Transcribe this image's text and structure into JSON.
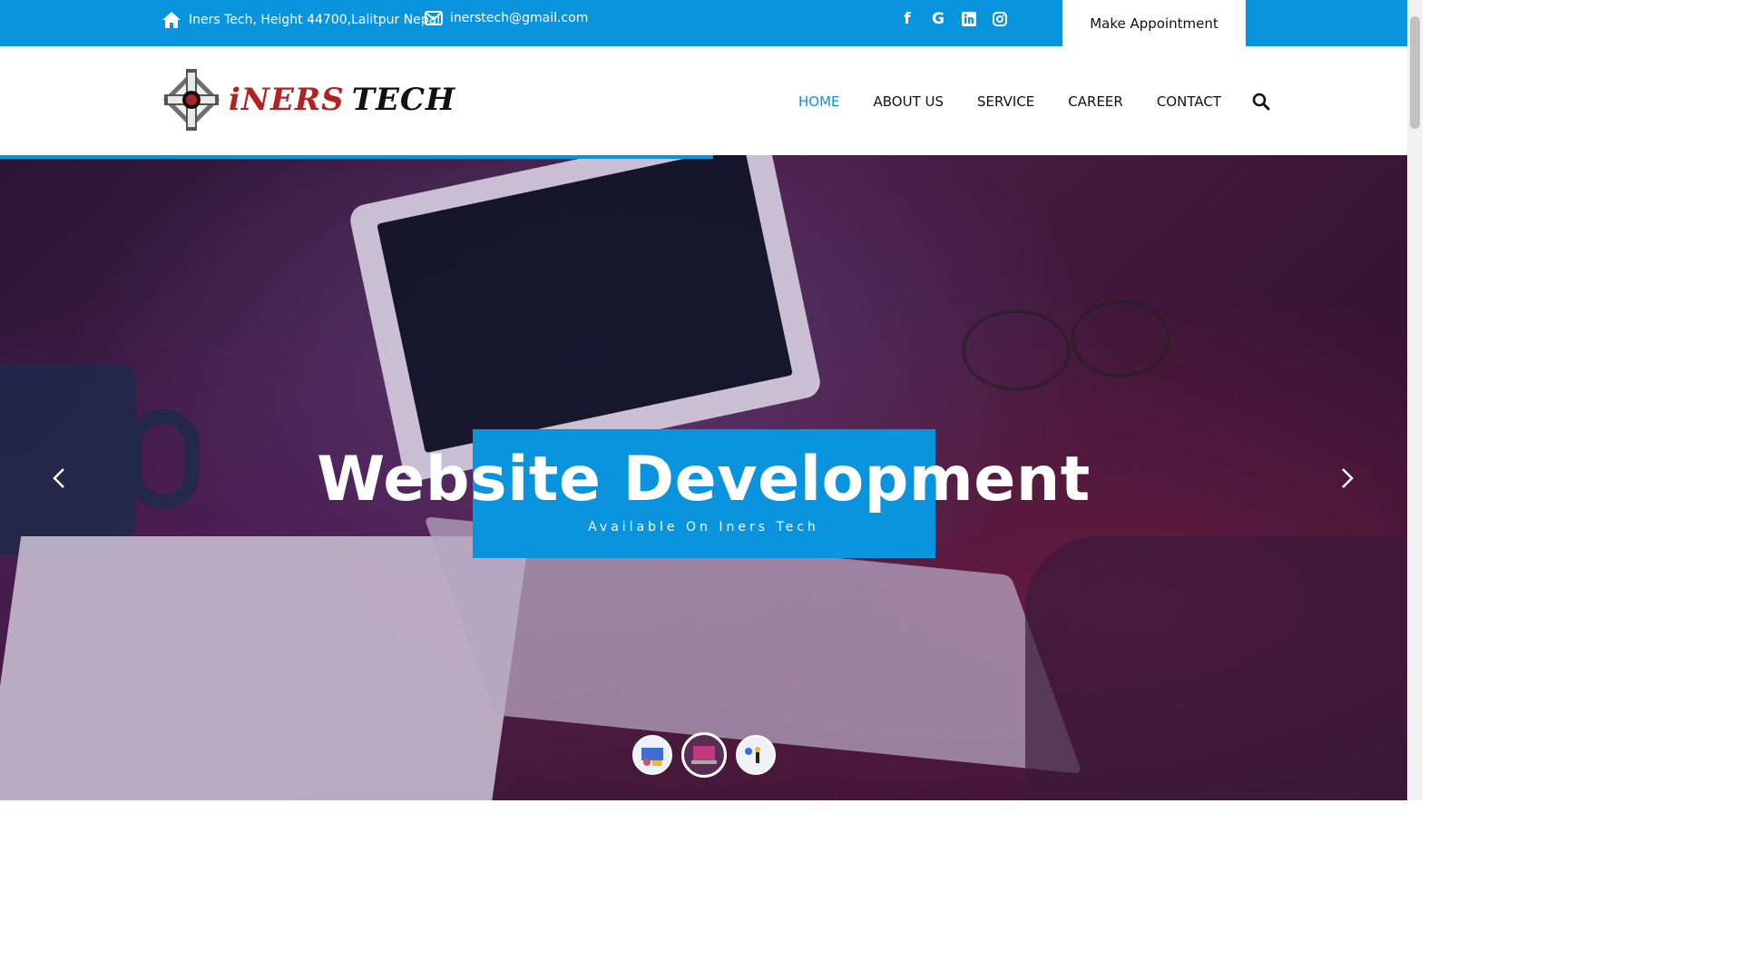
{
  "topbar": {
    "address": "Iners Tech, Height 44700,Lalitpur Nepal",
    "email": "inerstech@gmail.com",
    "social": [
      "facebook-icon",
      "google-icon",
      "linkedin-icon",
      "instagram-icon"
    ],
    "appointment_label": "Make Appointment"
  },
  "logo": {
    "part1": "iNERS",
    "part2": "TECH"
  },
  "nav": {
    "items": [
      {
        "label": "HOME",
        "active": true
      },
      {
        "label": "ABOUT US",
        "active": false
      },
      {
        "label": "SERVICE",
        "active": false
      },
      {
        "label": "CAREER",
        "active": false
      },
      {
        "label": "CONTACT",
        "active": false
      }
    ]
  },
  "slider": {
    "progress": 0.507,
    "title": "Website Development",
    "subtitle": "Available On Iners Tech",
    "active_slide": 2,
    "slide_count": 3
  },
  "colors": {
    "accent": "#0a94dd",
    "logo_red": "#b22222"
  }
}
